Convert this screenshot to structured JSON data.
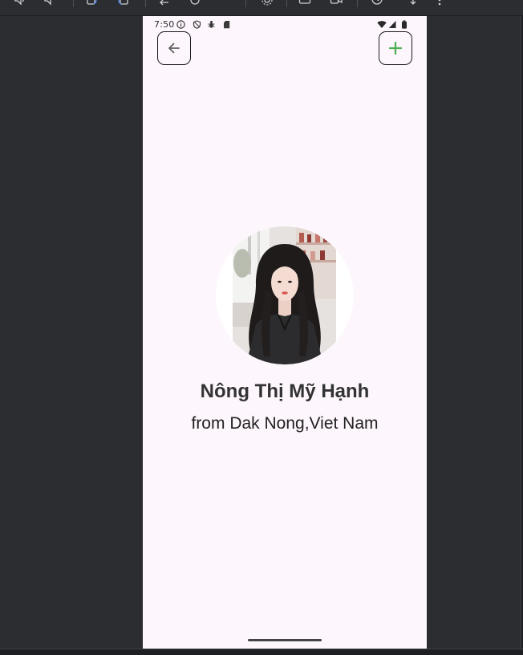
{
  "emulator_toolbar": {
    "icons": [
      "volume-up-icon",
      "volume-down-icon",
      "rotate-left-icon",
      "rotate-right-icon",
      "device-back-icon",
      "device-home-icon",
      "device-settings-icon",
      "screenshot-icon",
      "screen-record-icon",
      "snapshots-icon",
      "extended-controls-icon",
      "more-icon"
    ]
  },
  "status_bar": {
    "time": "7:50",
    "left_icons": [
      "info-icon",
      "shield-off-icon",
      "debug-icon",
      "sd-card-icon"
    ],
    "right_icons": [
      "wifi-icon",
      "signal-icon",
      "battery-icon"
    ]
  },
  "app_bar": {
    "back_icon": "arrow-back-icon",
    "add_icon": "add-icon"
  },
  "profile": {
    "name": "Nông Thị Mỹ Hạnh",
    "origin": "from Dak Nong,Viet Nam"
  },
  "colors": {
    "frame": "#2b2d30",
    "screen": "#fdf6fc",
    "accent": "#4caf50",
    "text": "#333333"
  }
}
